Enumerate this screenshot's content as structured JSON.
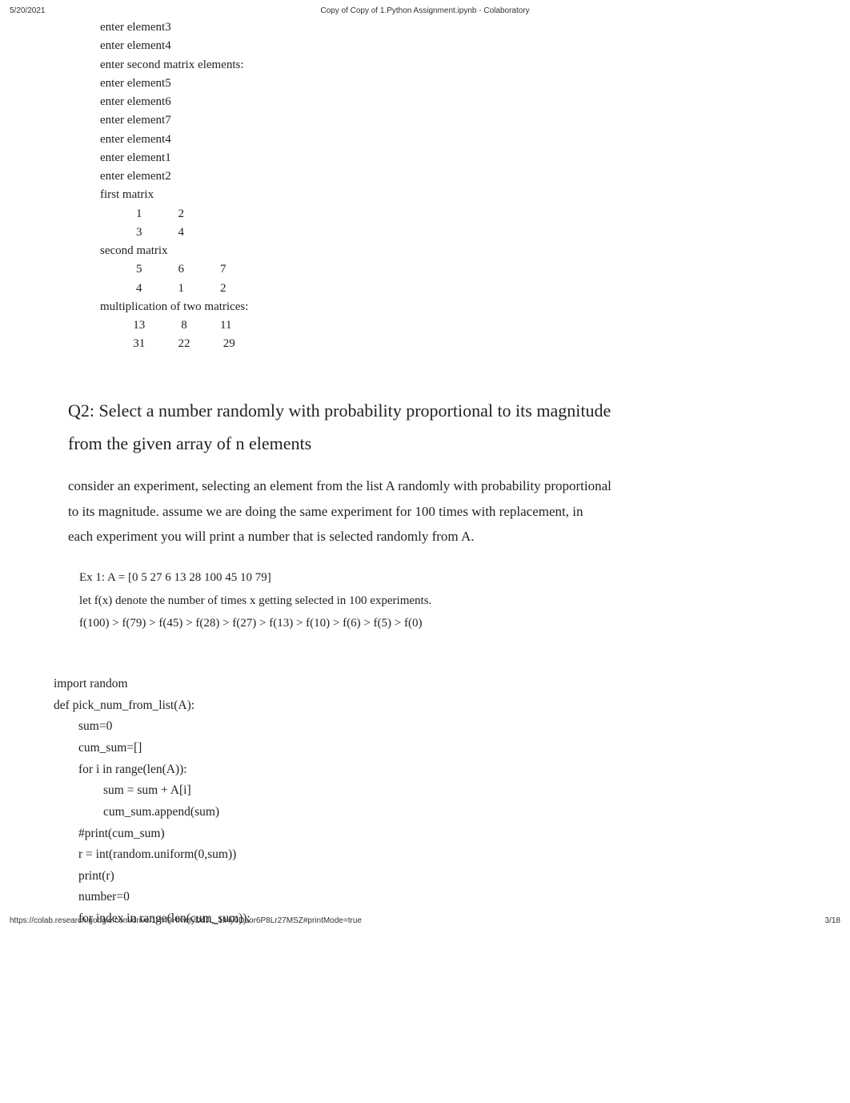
{
  "header": {
    "date": "5/20/2021",
    "title": "Copy of Copy of 1.Python Assignment.ipynb - Colaboratory"
  },
  "output": {
    "lines": [
      "enter element3",
      "enter element4",
      "enter second matrix elements:",
      "enter element5",
      "enter element6",
      "enter element7",
      "enter element4",
      "enter element1",
      "enter element2",
      "first matrix",
      "            1            2",
      "",
      "            3            4",
      "",
      "second matrix",
      "            5            6            7",
      "",
      "            4            1            2",
      "",
      "multiplication of two matrices:",
      "           13            8           11",
      "",
      "           31           22           29"
    ]
  },
  "heading": {
    "text1": "Q2: Select a number randomly with probability proportional to its magnitude",
    "text2": "from the given array of n elements"
  },
  "paragraph": {
    "line1": "consider an experiment, selecting an element from the list A randomly with probability proportional",
    "line2": "to its magnitude. assume we are doing the same experiment for 100 times with replacement, in",
    "line3": "each experiment you will print a number that is selected randomly from A."
  },
  "example": {
    "line1": "Ex 1: A = [0 5 27 6 13 28 100 45 10 79]",
    "line2": "let f(x) denote the number of times x getting selected in 100 experiments.",
    "line3": "f(100) > f(79) > f(45) > f(28) > f(27) > f(13) > f(10) > f(6) > f(5) > f(0)"
  },
  "code": {
    "lines": [
      "import random",
      "",
      "def pick_num_from_list(A):",
      "        sum=0",
      "        cum_sum=[]",
      "        for i in range(len(A)):",
      "                sum = sum + A[i]",
      "                cum_sum.append(sum)",
      "        #print(cum_sum)",
      "        r = int(random.uniform(0,sum))",
      "        print(r)",
      "        number=0",
      "        for index in range(len(cum_sum)):"
    ]
  },
  "footer": {
    "url": "https://colab.research.google.com/drive/1HH9HKwtyDdJL_1lHy9Daor6P8Lr27MSZ#printMode=true",
    "page": "3/18"
  }
}
